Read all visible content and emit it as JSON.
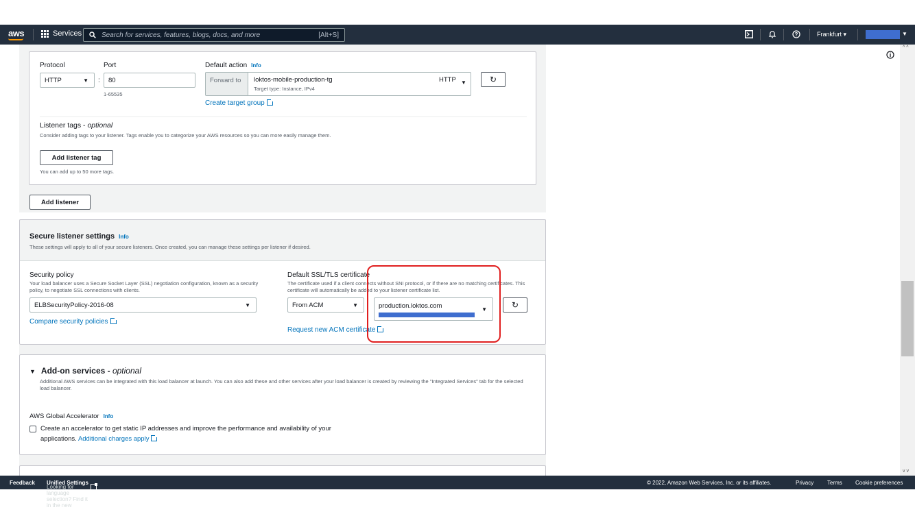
{
  "topbar": {
    "logo": "aws",
    "services_label": "Services",
    "search_placeholder": "Search for services, features, blogs, docs, and more",
    "search_shortcut": "[Alt+S]",
    "region": "Frankfurt ▾",
    "icons": [
      "cloudshell-icon",
      "bell-icon",
      "help-icon"
    ]
  },
  "listener": {
    "protocol_label": "Protocol",
    "protocol_value": "HTTP",
    "port_label": "Port",
    "port_value": "80",
    "port_hint": "1-65535",
    "default_action_label": "Default action",
    "info": "Info",
    "forward_to": "Forward to",
    "target_group": "loktos-mobile-production-tg",
    "target_type": "Target type: Instance, IPv4",
    "target_protocol": "HTTP",
    "create_target_group": "Create target group",
    "tags_title": "Listener tags - ",
    "tags_optional": "optional",
    "tags_desc": "Consider adding tags to your listener. Tags enable you to categorize your AWS resources so you can more easily manage them.",
    "add_tag_button": "Add listener tag",
    "tags_limit": "You can add up to 50 more tags."
  },
  "add_listener_button": "Add listener",
  "secure": {
    "title": "Secure listener settings",
    "info": "Info",
    "desc": "These settings will apply to all of your secure listeners. Once created, you can manage these settings per listener if desired.",
    "policy_label": "Security policy",
    "policy_desc": "Your load balancer uses a Secure Socket Layer (SSL) negotiation configuration, known as a security policy, to negotiate SSL connections with clients.",
    "policy_value": "ELBSecurityPolicy-2016-08",
    "compare_link": "Compare security policies",
    "cert_label": "Default SSL/TLS certificate",
    "cert_desc": "The certificate used if a client connects without SNI protocol, or if there are no matching certificates. This certificate will automatically be added to your listener certificate list.",
    "cert_source": "From ACM",
    "cert_value": "production.loktos.com",
    "request_link": "Request new ACM certificate"
  },
  "addon": {
    "title": "Add-on services - ",
    "optional": "optional",
    "desc": "Additional AWS services can be integrated with this load balancer at launch. You can also add these and other services after your load balancer is created by reviewing the \"Integrated Services\" tab for the selected load balancer.",
    "accelerator_label": "AWS Global Accelerator",
    "info": "Info",
    "checkbox_text": "Create an accelerator to get static IP addresses and improve the performance and availability of your",
    "checkbox_text2": "applications.",
    "charges_link": "Additional charges apply"
  },
  "footer": {
    "feedback": "Feedback",
    "lang_text": "Looking for language selection? Find it in the new ",
    "unified": "Unified Settings",
    "copyright": "© 2022, Amazon Web Services, Inc. or its affiliates.",
    "privacy": "Privacy",
    "terms": "Terms",
    "cookies": "Cookie preferences"
  },
  "colors": {
    "nav": "#232f3e",
    "link": "#0073bb",
    "highlight": "#e01e1e",
    "redaction": "#3f6ecf"
  }
}
